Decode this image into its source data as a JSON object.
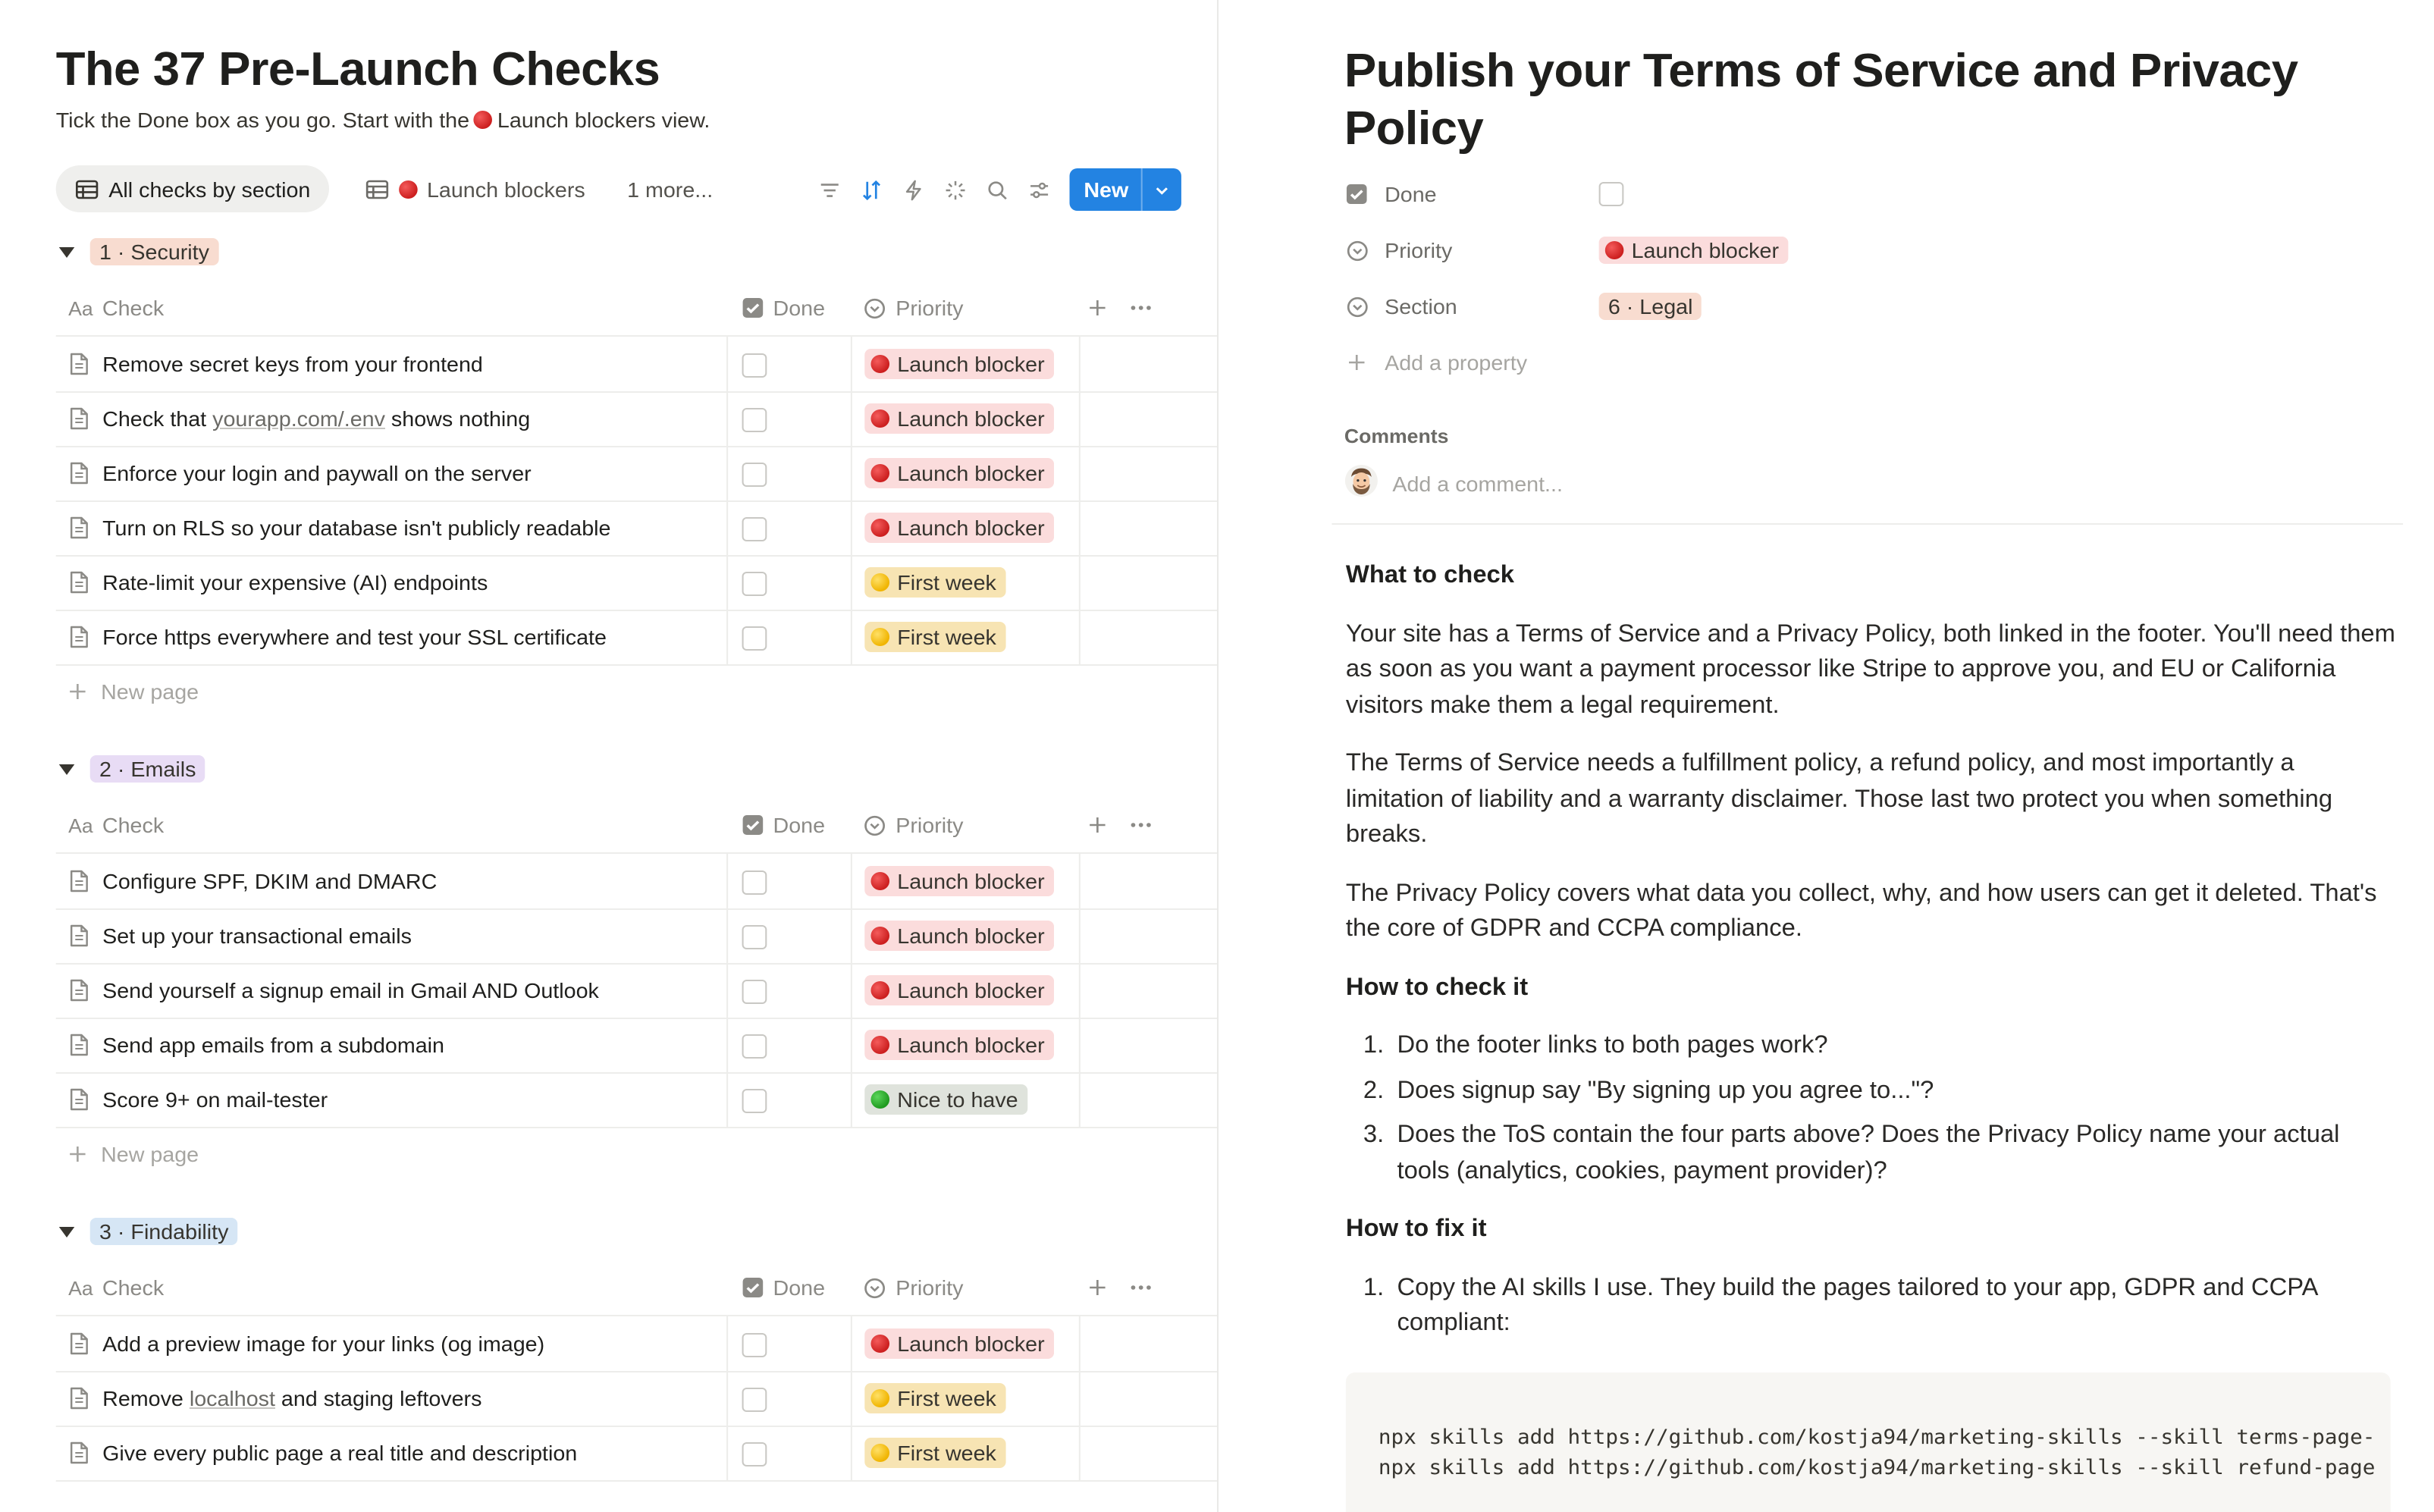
{
  "left": {
    "title": "The 37 Pre-Launch Checks",
    "subtitle_pre": "Tick the Done box as you go. Start with the",
    "subtitle_post": "Launch blockers view.",
    "views": {
      "tab1": "All checks by section",
      "tab2": "Launch blockers",
      "more": "1 more...",
      "new_label": "New"
    },
    "columns": {
      "check": "Check",
      "done": "Done",
      "priority": "Priority"
    },
    "new_page": "New page",
    "groups": [
      {
        "name": "1 · Security",
        "rows": [
          {
            "check": "Remove secret keys from your frontend",
            "priority": "Launch blocker"
          },
          {
            "check_pre": "Check that ",
            "check_link": "yourapp.com/.env",
            "check_post": " shows nothing",
            "priority": "Launch blocker"
          },
          {
            "check": "Enforce your login and paywall on the server",
            "priority": "Launch blocker"
          },
          {
            "check": "Turn on RLS so your database isn't publicly readable",
            "priority": "Launch blocker"
          },
          {
            "check": "Rate-limit your expensive (AI) endpoints",
            "priority": "First week"
          },
          {
            "check": "Force https everywhere and test your SSL certificate",
            "priority": "First week"
          }
        ]
      },
      {
        "name": "2 · Emails",
        "rows": [
          {
            "check": "Configure SPF, DKIM and DMARC",
            "priority": "Launch blocker"
          },
          {
            "check": "Set up your transactional emails",
            "priority": "Launch blocker"
          },
          {
            "check": "Send yourself a signup email in Gmail AND Outlook",
            "priority": "Launch blocker"
          },
          {
            "check": "Send app emails from a subdomain",
            "priority": "Launch blocker"
          },
          {
            "check": "Score 9+ on mail-tester",
            "priority": "Nice to have"
          }
        ]
      },
      {
        "name": "3 · Findability",
        "rows": [
          {
            "check": "Add a preview image for your links (og image)",
            "priority": "Launch blocker"
          },
          {
            "check_pre": "Remove ",
            "check_link": "localhost",
            "check_post": " and staging leftovers",
            "priority": "First week"
          },
          {
            "check": "Give every public page a real title and description",
            "priority": "First week"
          }
        ]
      }
    ]
  },
  "right": {
    "title": "Publish your Terms of Service and Privacy Policy",
    "props": {
      "done_label": "Done",
      "priority_label": "Priority",
      "priority_value": "Launch blocker",
      "section_label": "Section",
      "section_value": "6 · Legal",
      "add_property": "Add a property"
    },
    "comments_label": "Comments",
    "comment_placeholder": "Add a comment...",
    "what_heading": "What to check",
    "what_p1": "Your site has a Terms of Service and a Privacy Policy, both linked in the footer. You'll need them as soon as you want a payment processor like Stripe to approve you, and EU or California visitors make them a legal requirement.",
    "what_p2": "The Terms of Service needs a fulfillment policy, a refund policy, and most importantly a limitation of liability and a warranty disclaimer. Those last two protect you when something breaks.",
    "what_p3": "The Privacy Policy covers what data you collect, why, and how users can get it deleted. That's the core of GDPR and CCPA compliance.",
    "how_check_heading": "How to check it",
    "how_check_items": [
      "Do the footer links to both pages work?",
      "Does signup say \"By signing up you agree to...\"?",
      "Does the ToS contain the four parts above? Does the Privacy Policy name your actual tools (analytics, cookies, payment provider)?"
    ],
    "how_fix_heading": "How to fix it",
    "how_fix_items": [
      "Copy the AI skills I use. They build the pages tailored to your app, GDPR and CCPA compliant:"
    ],
    "code_line1": "npx skills add https://github.com/kostja94/marketing-skills --skill terms-page-",
    "code_line2": "npx skills add https://github.com/kostja94/marketing-skills --skill refund-page"
  },
  "colors": {
    "accent": "#2383e2",
    "launch_blocker_bg": "#fbdcdc",
    "first_week_bg": "#f7e4b3",
    "nice_to_have_bg": "#dfe3dc",
    "security_tag": "#f8dcd0",
    "emails_tag": "#e8dcf5",
    "findability_tag": "#d6e6f5"
  },
  "icons": [
    "table-icon",
    "filter-icon",
    "sort-icon",
    "lightning-icon",
    "sparkle-icon",
    "search-icon",
    "settings-sliders-icon",
    "chevron-down-icon",
    "page-icon",
    "checkbox-icon",
    "select-icon",
    "plus-icon",
    "more-icon",
    "red-circle-icon",
    "yellow-circle-icon",
    "green-circle-icon",
    "avatar"
  ]
}
